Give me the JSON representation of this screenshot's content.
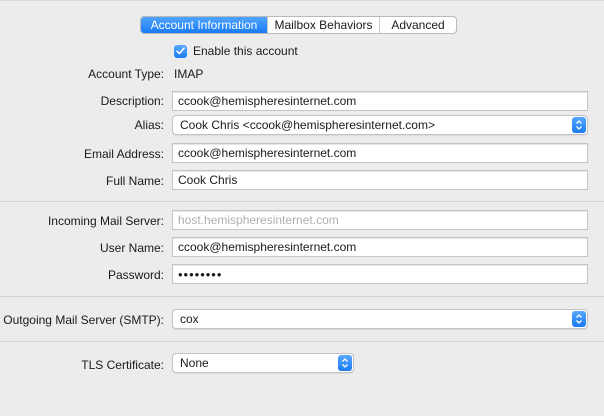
{
  "tabs": [
    {
      "label": "Account Information",
      "active": true
    },
    {
      "label": "Mailbox Behaviors",
      "active": false
    },
    {
      "label": "Advanced",
      "active": false
    }
  ],
  "enable_account": {
    "label": "Enable this account",
    "checked": true
  },
  "account_type": {
    "label": "Account Type:",
    "value": "IMAP"
  },
  "description": {
    "label": "Description:",
    "value": "ccook@hemispheresinternet.com"
  },
  "alias": {
    "label": "Alias:",
    "value": "Cook Chris <ccook@hemispheresinternet.com>"
  },
  "email_address": {
    "label": "Email Address:",
    "value": "ccook@hemispheresinternet.com"
  },
  "full_name": {
    "label": "Full Name:",
    "value": "Cook Chris"
  },
  "incoming_server": {
    "label": "Incoming Mail Server:",
    "placeholder": "host.hemispheresinternet.com"
  },
  "user_name": {
    "label": "User Name:",
    "value": "ccook@hemispheresinternet.com"
  },
  "password": {
    "label": "Password:",
    "value": "••••••••"
  },
  "outgoing_server": {
    "label": "Outgoing Mail Server (SMTP):",
    "value": "cox"
  },
  "tls_certificate": {
    "label": "TLS Certificate:",
    "value": "None"
  },
  "colors": {
    "accent": "#1a7cf5",
    "background": "#ececec"
  }
}
